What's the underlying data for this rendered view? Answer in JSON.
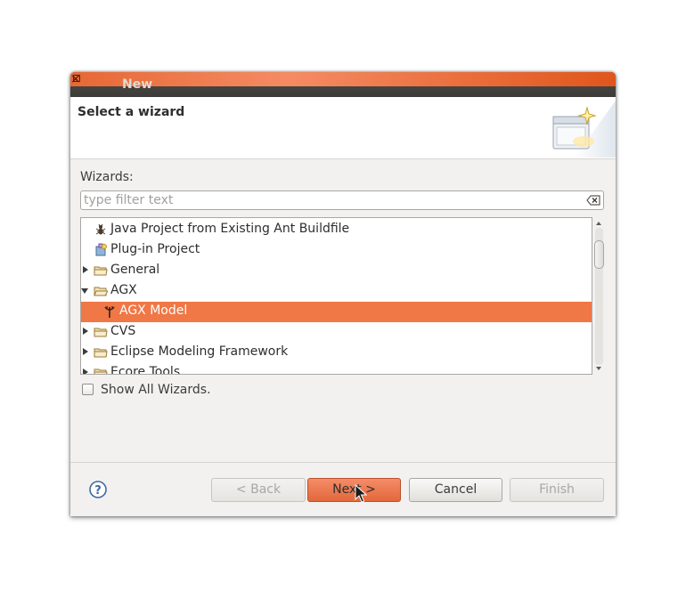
{
  "window": {
    "title": "New"
  },
  "header": {
    "title": "Select a wizard",
    "icon": "new-wizard-banner-icon"
  },
  "wizards_label": "Wizards:",
  "filter": {
    "value": "",
    "placeholder": "type filter text",
    "clear_icon": "clear-filter-icon"
  },
  "tree": {
    "items": [
      {
        "label": "Java Project from Existing Ant Buildfile",
        "icon": "ant-icon",
        "expander": "none",
        "selected": false
      },
      {
        "label": "Plug-in Project",
        "icon": "plugin-icon",
        "expander": "none",
        "selected": false
      },
      {
        "label": "General",
        "icon": "folder-icon",
        "expander": "collapsed",
        "selected": false
      },
      {
        "label": "AGX",
        "icon": "folder-icon",
        "expander": "expanded",
        "selected": false
      },
      {
        "label": "AGX Model",
        "icon": "agx-model-icon",
        "expander": "none",
        "selected": true
      },
      {
        "label": "CVS",
        "icon": "folder-icon",
        "expander": "collapsed",
        "selected": false
      },
      {
        "label": "Eclipse Modeling Framework",
        "icon": "folder-icon",
        "expander": "collapsed",
        "selected": false
      },
      {
        "label": "Ecore Tools",
        "icon": "folder-icon",
        "expander": "collapsed",
        "selected": false
      }
    ]
  },
  "show_all": {
    "label": "Show All Wizards.",
    "checked": false
  },
  "buttons": {
    "back": "< Back",
    "next": "Next >",
    "cancel": "Cancel",
    "finish": "Finish"
  },
  "colors": {
    "selection": "#f07746",
    "titlebar": "#3c3b37",
    "default_button": "#e2683c"
  }
}
